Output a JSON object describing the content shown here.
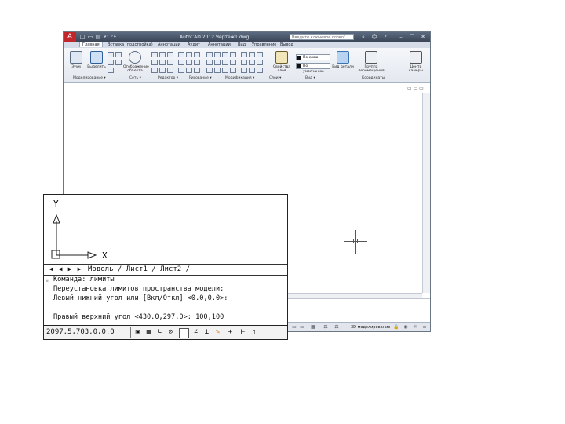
{
  "window": {
    "title": "AutoCAD 2012  Чертеж1.dwg",
    "search_placeholder": "Введите ключевое слово/фразу",
    "app_button": "A",
    "quick_access": [
      "□",
      "▭",
      "▤",
      "↶",
      "↷"
    ],
    "window_buttons": [
      "–",
      "❐",
      "✕"
    ]
  },
  "ribbon": {
    "tabs": [
      "Главная",
      "Вставка (подстройка)",
      "Аннотации",
      "Аудит",
      "Аннотации",
      "Вид",
      "Управление",
      "Вывод"
    ],
    "active_tab": "Главная",
    "big_buttons": [
      {
        "label": "Зуум",
        "icon": "zoom-icon"
      },
      {
        "label": "Выделить",
        "icon": "select-icon"
      },
      {
        "label": "Отображение объекта",
        "icon": "object-display-icon"
      },
      {
        "label": "Свойства слоя",
        "icon": "layer-properties-icon"
      },
      {
        "label": "Вид детали",
        "icon": "view-detail-icon"
      },
      {
        "label": "Группа перемещения",
        "icon": "group-move-icon"
      },
      {
        "label": "Центр камеры",
        "icon": "camera-icon"
      }
    ],
    "panels": [
      "Моделирование ▾",
      "Сеть ▾",
      "Редактор ▾",
      "Рисование ▾",
      "Модификация ▾",
      "Слои ▾",
      "Вид ▾",
      "Координаты"
    ],
    "combos": [
      {
        "value": "По слою"
      },
      {
        "value": "По умолчанию"
      }
    ]
  },
  "inset": {
    "axis_y_label": "Y",
    "axis_x_label": "X",
    "layout_nav": [
      "◀",
      "◀",
      "▶",
      "▶"
    ],
    "layout_tabs": "Модель / Лист1 / Лист2 /",
    "command_lines": [
      "Команда: лимиты",
      "Переустановка лимитов пространства модели:",
      "Левый нижний угол или [Вкл/Откл] <0.0,0.0>:",
      "Правый верхний угол <430.0,297.0>: 100,100"
    ],
    "coordinates": "2097.5,703.0,0.0",
    "status_icons": [
      "snap-icon",
      "grid-icon",
      "ortho-icon",
      "polar-icon",
      "osnap-icon",
      "otrack-icon",
      "ducs-icon",
      "dyn-icon",
      "lineweight-icon"
    ]
  },
  "statusbar": {
    "workspace_label": "3D моделирование"
  },
  "viewport_controls": "▭ ▭ ▭"
}
